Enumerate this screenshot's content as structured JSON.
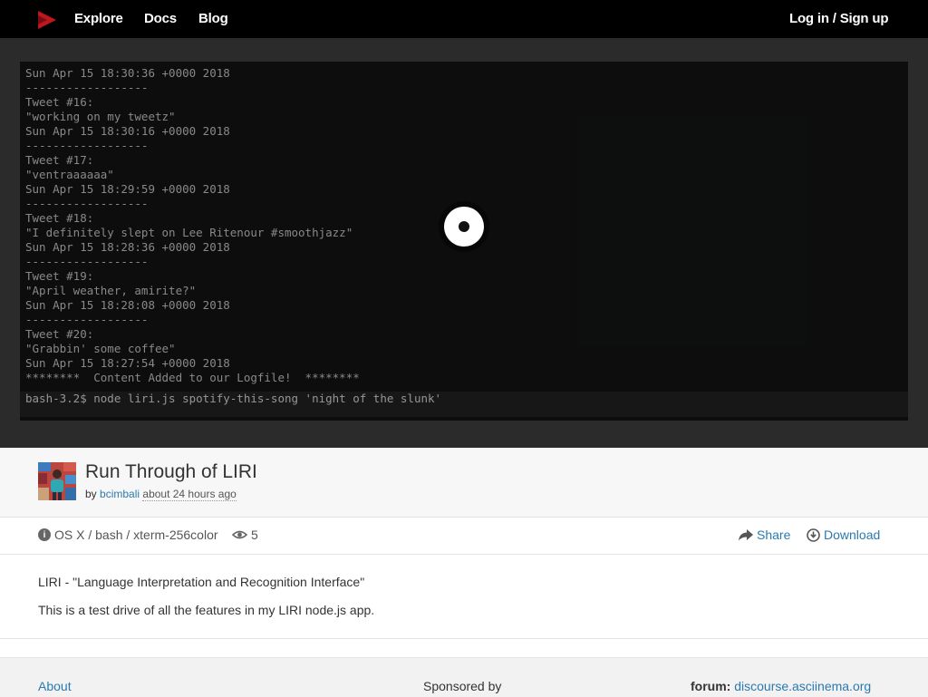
{
  "nav": {
    "logo_icon": "asciinema-logo-icon",
    "explore": "Explore",
    "docs": "Docs",
    "blog": "Blog",
    "login": "Log in / Sign up"
  },
  "terminal": {
    "lines": [
      "Sun Apr 15 18:30:36 +0000 2018",
      "------------------",
      "Tweet #16:",
      "\"working on my tweetz\"",
      "Sun Apr 15 18:30:16 +0000 2018",
      "------------------",
      "Tweet #17:",
      "\"ventraaaaaa\"",
      "Sun Apr 15 18:29:59 +0000 2018",
      "------------------",
      "Tweet #18:",
      "\"I definitely slept on Lee Ritenour #smoothjazz\"",
      "Sun Apr 15 18:28:36 +0000 2018",
      "------------------",
      "Tweet #19:",
      "\"April weather, amirite?\"",
      "Sun Apr 15 18:28:08 +0000 2018",
      "------------------",
      "Tweet #20:",
      "\"Grabbin' some coffee\"",
      "Sun Apr 15 18:27:54 +0000 2018",
      "********  Content Added to our Logfile!  ********"
    ],
    "command": "bash-3.2$ node liri.js spotify-this-song 'night of the slunk'",
    "play_icon": "play-button-icon"
  },
  "recording": {
    "title": "Run Through of LIRI",
    "by_label": "by",
    "author": "bcimbali",
    "time_ago": "about 24 hours ago"
  },
  "info": {
    "env": "OS X / bash / xterm-256color",
    "views": "5",
    "share": "Share",
    "download": "Download"
  },
  "description": {
    "line1": "LIRI - \"Language Interpretation and Recognition Interface\"",
    "line2": "This is a test drive of all the features in my LIRI node.js app."
  },
  "footer": {
    "about": "About",
    "sponsored": "Sponsored by",
    "forum_label": "forum:",
    "forum_link": "discourse.asciinema.org"
  },
  "colors": {
    "navbar_bg": "#000000",
    "link": "#2a7aaf",
    "logo": "#c0161f",
    "terminal_bg": "#121314"
  }
}
